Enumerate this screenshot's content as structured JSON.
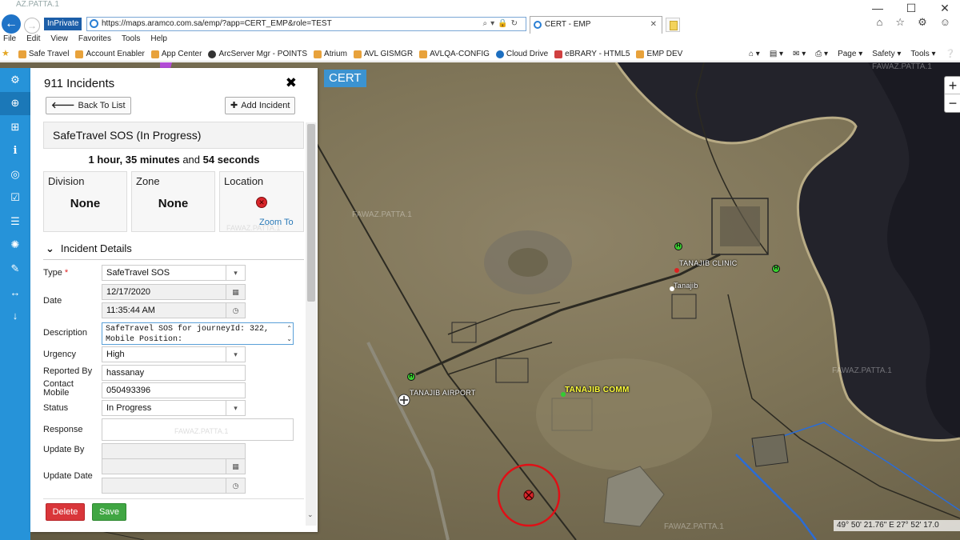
{
  "browser": {
    "url": "https://maps.aramco.com.sa/emp/?app=CERT_EMP&role=TEST",
    "inprivate": "InPrivate",
    "tab_title": "CERT - EMP",
    "tab_strip_text": "AZ.PATTA.1",
    "menu": [
      "File",
      "Edit",
      "View",
      "Favorites",
      "Tools",
      "Help"
    ],
    "favorites": [
      {
        "label": "Safe Travel",
        "icon": "favorite-icon"
      },
      {
        "label": "Account Enabler",
        "icon": "favorite-icon"
      },
      {
        "label": "App Center",
        "icon": "favorite-icon"
      },
      {
        "label": "ArcServer Mgr - POINTS",
        "icon": "arc-icon"
      },
      {
        "label": "Atrium",
        "icon": "favorite-icon"
      },
      {
        "label": "AVL GISMGR",
        "icon": "favorite-icon"
      },
      {
        "label": "AVLQA-CONFIG",
        "icon": "favorite-icon"
      },
      {
        "label": "Cloud Drive",
        "icon": "cloud-icon"
      },
      {
        "label": "eBRARY - HTML5",
        "icon": "ebrary-icon"
      },
      {
        "label": "EMP DEV",
        "icon": "favorite-icon"
      }
    ],
    "commands": [
      "Page ▾",
      "Safety ▾",
      "Tools ▾"
    ]
  },
  "map": {
    "badge": "CERT",
    "zoom_in": "+",
    "zoom_out": "−",
    "coordinates": "49° 50' 21.76\" E 27° 52' 17.0",
    "labels": {
      "clinic": "TANAJIB CLINIC",
      "tanajib": "Tanajib",
      "airport": "TANAJIB AIRPORT",
      "comm": "TANAJIB COMM"
    },
    "h_marker": "H",
    "watermark": "FAWAZ.PATTA.1"
  },
  "toolbar": {
    "tools": [
      "gear-icon",
      "medkit-icon",
      "sitemap-icon",
      "info-icon",
      "target-icon",
      "checklist-icon",
      "list-icon",
      "cog-icon",
      "edit-icon",
      "resize-icon",
      "arrow-down-icon"
    ]
  },
  "panel": {
    "title": "911 Incidents",
    "back_label": "Back To List",
    "add_label": "Add Incident",
    "status": "SafeTravel SOS (In Progress)",
    "elapsed": {
      "hours": "1",
      "hours_unit": "hour,",
      "minutes": "35",
      "minutes_unit": "minutes",
      "and": "and",
      "seconds": "54",
      "seconds_unit": "seconds"
    },
    "cards": {
      "division_label": "Division",
      "division_value": "None",
      "zone_label": "Zone",
      "zone_value": "None",
      "location_label": "Location",
      "zoom_to": "Zoom To"
    },
    "details_header": "Incident Details",
    "watermark": "FAWAZ.PATTA.1",
    "fields": {
      "type_label": "Type",
      "type_value": "SafeTravel SOS",
      "date_label": "Date",
      "date_value": "12/17/2020",
      "time_value": "11:35:44 AM",
      "description_label": "Description",
      "description_value": "SafeTravel SOS for journeyId: 322, Mobile Position:",
      "urgency_label": "Urgency",
      "urgency_value": "High",
      "reported_by_label": "Reported By",
      "reported_by_value": "hassanay",
      "contact_label_1": "Contact",
      "contact_label_2": "Mobile",
      "contact_value": "050493396",
      "status_label": "Status",
      "status_value": "In Progress",
      "response_label": "Response",
      "response_value": "",
      "update_by_label": "Update By",
      "update_by_value": "",
      "update_date_label": "Update Date",
      "update_date_value": "",
      "update_time_value": ""
    },
    "delete_label": "Delete",
    "save_label": "Save"
  },
  "colors": {
    "toolbar_blue": "#2693d9",
    "delete_red": "#d9363a",
    "save_green": "#40a643",
    "incident_marker_red": "#d9262b",
    "road_blue": "#2b6cd6"
  }
}
